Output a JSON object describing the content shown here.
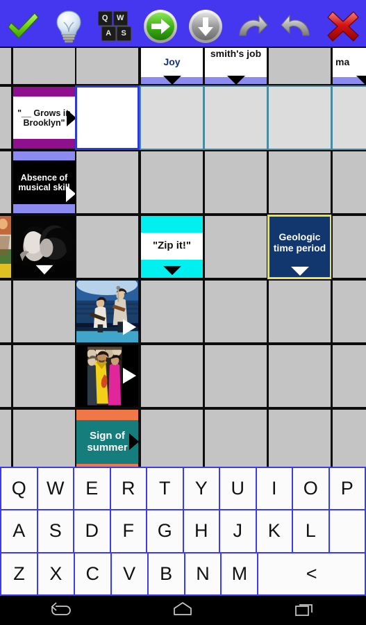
{
  "toolbar": {
    "buttons": [
      {
        "name": "check-button",
        "icon": "green-check-icon",
        "label": "Check"
      },
      {
        "name": "hint-button",
        "icon": "lightbulb-icon",
        "label": "Hint"
      },
      {
        "name": "keyboard-button",
        "icon": "keyboard-icon",
        "label": "Keyboard"
      },
      {
        "name": "next-button",
        "icon": "green-right-arrow-icon",
        "label": "Next"
      },
      {
        "name": "down-button",
        "icon": "gray-down-arrow-icon",
        "label": "Down"
      },
      {
        "name": "redo-button",
        "icon": "redo-icon",
        "label": "Redo"
      },
      {
        "name": "undo-button",
        "icon": "undo-icon",
        "label": "Undo"
      },
      {
        "name": "close-button",
        "icon": "red-x-icon",
        "label": "Close"
      }
    ],
    "keyboard_icon_keys": [
      "Q",
      "W",
      "A",
      "S"
    ],
    "background_color": "#4536f0"
  },
  "grid": {
    "clues": {
      "joy": "Joy",
      "smiths_job": "smith's job",
      "ma_partial": "ma",
      "grows_in_brooklyn": "\"__ Grows in Brooklyn\"",
      "absence_of_musical_skill": "Absence of musical skill",
      "zip_it": "\"Zip it!\"",
      "geologic_time_period": "Geologic time period",
      "sign_of_summer": "Sign of summer"
    },
    "colors": {
      "cell_fill": "#c4c4c4",
      "highlight_fill": "#dcdcdc",
      "highlight_border": "#4a8a9e",
      "active_border": "#2a3ad8",
      "periwinkle_band": "#8c8cf0",
      "purple_band": "#8f0f8f",
      "cyan_band": "#00f0f0",
      "orange_band": "#f07848",
      "teal_fill": "#167d7d",
      "navy_fill": "#12376e",
      "yellow_border": "#f0e040",
      "joy_text": "#14307a"
    }
  },
  "keyboard": {
    "rows": [
      [
        "Q",
        "W",
        "E",
        "R",
        "T",
        "Y",
        "U",
        "I",
        "O",
        "P"
      ],
      [
        "A",
        "S",
        "D",
        "F",
        "G",
        "H",
        "J",
        "K",
        "L",
        ""
      ],
      [
        "Z",
        "X",
        "C",
        "V",
        "B",
        "N",
        "M",
        "<"
      ]
    ],
    "backspace_label": "<",
    "background_color": "#3b3bef",
    "key_color": "#fbfbfb"
  },
  "navbar": {
    "buttons": [
      {
        "name": "nav-back-button",
        "label": "Back"
      },
      {
        "name": "nav-home-button",
        "label": "Home"
      },
      {
        "name": "nav-recents-button",
        "label": "Recent apps"
      }
    ]
  }
}
